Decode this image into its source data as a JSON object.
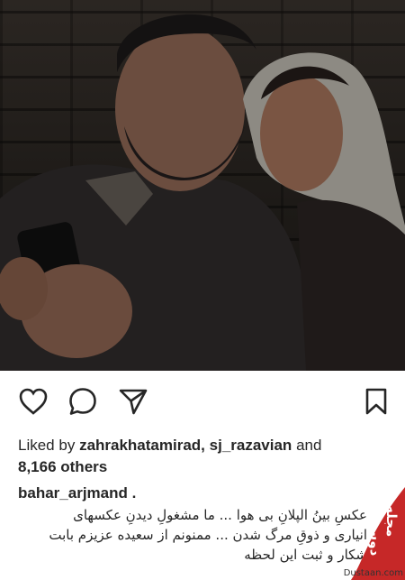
{
  "post": {
    "image": {
      "alt": ""
    },
    "actions": {
      "like_icon": "heart-outline-icon",
      "comment_icon": "comment-bubble-icon",
      "share_icon": "paper-plane-icon",
      "save_icon": "bookmark-icon"
    },
    "likes": {
      "prefix": "Liked by",
      "user1": "zahrakhatamirad,",
      "user2": "sj_razavian",
      "conj": "and",
      "others": "8,166 others"
    },
    "caption": {
      "username": "bahar_arjmand .",
      "line1": "عکسِ بینُ الپلانِ بی هوا ... ما مشغولِ دیدنِ عکسهای",
      "line2": "انیاری و ذوقِ مرگ شدن ... ممنونم از سعیده عزیزم بابت",
      "line3": "شکار و ثبت این لحظه"
    }
  },
  "watermark": {
    "site_text": "Dustaan.com",
    "logo_text": "مجله دوستان"
  },
  "colors": {
    "text": "#262626",
    "watermark_red": "#c62828",
    "icon": "#262626"
  }
}
